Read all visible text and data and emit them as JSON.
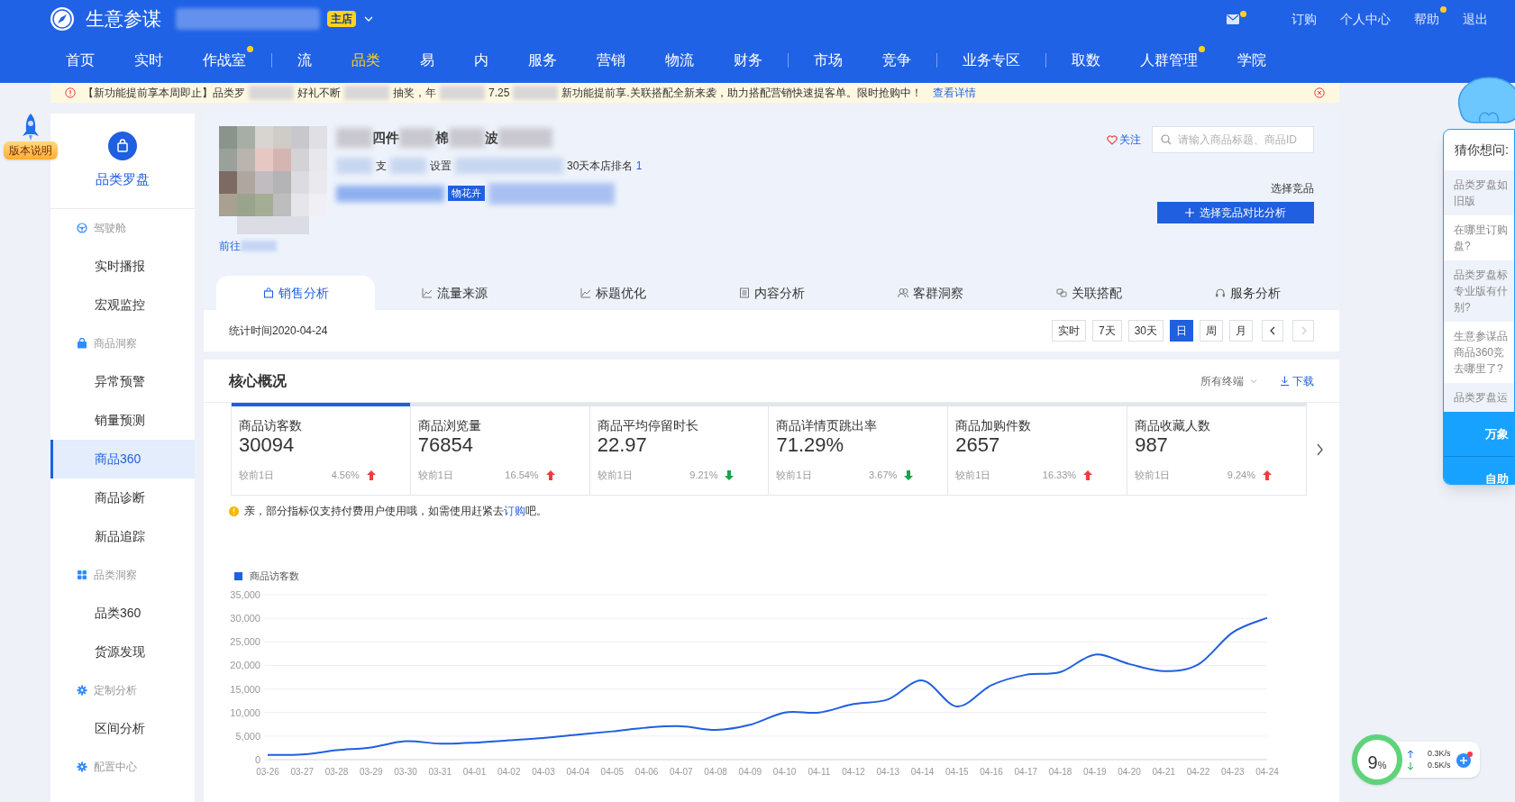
{
  "header": {
    "brand": "生意参谋",
    "shop_badge": "主店",
    "mail_dot": true,
    "links": [
      {
        "label": "订购",
        "dot": false
      },
      {
        "label": "个人中心",
        "dot": false
      },
      {
        "label": "帮助",
        "dot": true
      },
      {
        "label": "退出",
        "dot": false
      }
    ]
  },
  "nav_groups": [
    [
      {
        "label": "首页",
        "selected": false,
        "dot": false
      },
      {
        "label": "实时",
        "selected": false,
        "dot": false
      },
      {
        "label": "作战室",
        "selected": false,
        "dot": true
      }
    ],
    [
      {
        "label": "流",
        "selected": false,
        "dot": false
      },
      {
        "label": "品类",
        "selected": true,
        "dot": false
      },
      {
        "label": "易",
        "selected": false,
        "dot": false
      },
      {
        "label": "内",
        "selected": false,
        "dot": false
      },
      {
        "label": "服务",
        "selected": false,
        "dot": false
      },
      {
        "label": "营销",
        "selected": false,
        "dot": false
      },
      {
        "label": "物流",
        "selected": false,
        "dot": false
      },
      {
        "label": "财务",
        "selected": false,
        "dot": false
      }
    ],
    [
      {
        "label": "市场",
        "selected": false,
        "dot": false
      },
      {
        "label": "竞争",
        "selected": false,
        "dot": false
      }
    ],
    [
      {
        "label": "业务专区",
        "selected": false,
        "dot": false
      }
    ],
    [
      {
        "label": "取数",
        "selected": false,
        "dot": false
      },
      {
        "label": "人群管理",
        "selected": false,
        "dot": true
      },
      {
        "label": "学院",
        "selected": false,
        "dot": false
      }
    ]
  ],
  "notice": {
    "segments": [
      "【新功能提前享本周即止】品类罗",
      "好礼不断",
      "抽奖，年",
      "7.25",
      "新功能提前享.关联搭配全新来袭，助力搭配营销快速提客单。限时抢购中！"
    ],
    "link": "查看详情"
  },
  "version_badge": "版本说明",
  "sidebar": {
    "title": "品类罗盘",
    "sections": [
      {
        "label": "驾驶舱",
        "items": [
          {
            "label": "实时播报",
            "selected": false
          },
          {
            "label": "宏观监控",
            "selected": false
          }
        ]
      },
      {
        "label": "商品洞察",
        "items": [
          {
            "label": "异常预警",
            "selected": false
          },
          {
            "label": "销量预测",
            "selected": false
          },
          {
            "label": "商品360",
            "selected": true
          },
          {
            "label": "商品诊断",
            "selected": false
          },
          {
            "label": "新品追踪",
            "selected": false
          }
        ]
      },
      {
        "label": "品类洞察",
        "items": [
          {
            "label": "品类360",
            "selected": false
          },
          {
            "label": "货源发现",
            "selected": false
          }
        ]
      },
      {
        "label": "定制分析",
        "items": [
          {
            "label": "区间分析",
            "selected": false
          }
        ]
      },
      {
        "label": "配置中心"
      }
    ]
  },
  "product": {
    "title_fragments": [
      "四件",
      "棉",
      "波"
    ],
    "meta_fragments": [
      "支",
      "设置"
    ],
    "rank_label": "30天本店排名",
    "rank": "1",
    "tag": "物花卉",
    "link_fragment": "前往",
    "follow": "关注",
    "search_placeholder": "请输入商品标题、商品ID",
    "compare_label": "选择竞品",
    "compare_button": "选择竞品对比分析"
  },
  "tabs": [
    {
      "label": "销售分析",
      "selected": true
    },
    {
      "label": "流量来源",
      "selected": false
    },
    {
      "label": "标题优化",
      "selected": false
    },
    {
      "label": "内容分析",
      "selected": false
    },
    {
      "label": "客群洞察",
      "selected": false
    },
    {
      "label": "关联搭配",
      "selected": false
    },
    {
      "label": "服务分析",
      "selected": false
    }
  ],
  "stat_time": "统计时间2020-04-24",
  "periods": [
    {
      "label": "实时",
      "selected": false
    },
    {
      "label": "7天",
      "selected": false
    },
    {
      "label": "30天",
      "selected": false
    },
    {
      "label": "日",
      "selected": true
    },
    {
      "label": "周",
      "selected": false
    },
    {
      "label": "月",
      "selected": false
    }
  ],
  "pager": {
    "prev_disabled": false,
    "next_disabled": true
  },
  "overview": {
    "title": "核心概况",
    "terminal": "所有终端",
    "download": "下载",
    "metrics": [
      {
        "label": "商品访客数",
        "value": "30094",
        "compare": "较前1日",
        "change": "4.56%",
        "rising": true,
        "selected": true
      },
      {
        "label": "商品浏览量",
        "value": "76854",
        "compare": "较前1日",
        "change": "16.54%",
        "rising": true,
        "selected": false
      },
      {
        "label": "商品平均停留时长",
        "value": "22.97",
        "compare": "较前1日",
        "change": "9.21%",
        "rising": false,
        "selected": false
      },
      {
        "label": "商品详情页跳出率",
        "value": "71.29%",
        "compare": "较前1日",
        "change": "3.67%",
        "rising": false,
        "selected": false
      },
      {
        "label": "商品加购件数",
        "value": "2657",
        "compare": "较前1日",
        "change": "16.33%",
        "rising": true,
        "selected": false
      },
      {
        "label": "商品收藏人数",
        "value": "987",
        "compare": "较前1日",
        "change": "9.24%",
        "rising": true,
        "selected": false
      }
    ],
    "hint_before": "亲，部分指标仅支持付费用户使用哦，如需使用赶紧去",
    "hint_link": "订购",
    "hint_after": "吧。",
    "chart_data": {
      "type": "line",
      "categories": [
        "03-26",
        "03-27",
        "03-28",
        "03-29",
        "03-30",
        "03-31",
        "04-01",
        "04-02",
        "04-03",
        "04-04",
        "04-05",
        "04-06",
        "04-07",
        "04-08",
        "04-09",
        "04-10",
        "04-11",
        "04-12",
        "04-13",
        "04-14",
        "04-15",
        "04-16",
        "04-17",
        "04-18",
        "04-19",
        "04-20",
        "04-21",
        "04-22",
        "04-23",
        "04-24"
      ],
      "series": [
        {
          "name": "商品访客数",
          "color": "#1f5fe0",
          "values": [
            1000,
            1100,
            2000,
            2600,
            3900,
            3400,
            3600,
            4100,
            4600,
            5300,
            6000,
            6800,
            7100,
            6300,
            7400,
            10000,
            10000,
            11800,
            12800,
            16800,
            11300,
            15800,
            18000,
            18600,
            22300,
            20300,
            18800,
            20200,
            27000,
            30100
          ]
        }
      ],
      "grid": true,
      "ylim": [
        0,
        35000
      ],
      "yticks": [
        {
          "value": 0,
          "label": "0"
        },
        {
          "value": 5000,
          "label": "5,000"
        },
        {
          "value": 10000,
          "label": "10,000"
        },
        {
          "value": 15000,
          "label": "15,000"
        },
        {
          "value": 20000,
          "label": "20,000"
        },
        {
          "value": 25000,
          "label": "25,000"
        },
        {
          "value": 30000,
          "label": "30,000"
        },
        {
          "value": 35000,
          "label": "35,000"
        }
      ]
    }
  },
  "assistant": {
    "title": "猜你想问:",
    "questions": [
      {
        "lines": [
          "品类罗盘如",
          "旧版"
        ]
      },
      {
        "lines": [
          "在哪里订购",
          "盘?"
        ]
      },
      {
        "lines": [
          "品类罗盘标",
          "专业版有什",
          "别?"
        ]
      },
      {
        "lines": [
          "生意参谋品",
          "商品360竞",
          "去哪里了?"
        ]
      },
      {
        "lines": [
          "品类罗盘运"
        ]
      }
    ],
    "buttons": [
      "万象",
      "自助"
    ]
  },
  "speed_widget": {
    "percent": "9",
    "unit": "%",
    "up": "0.3K/s",
    "down": "0.5K/s"
  }
}
